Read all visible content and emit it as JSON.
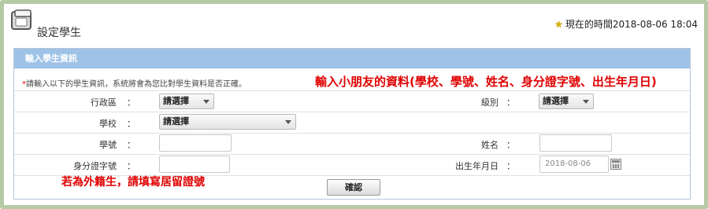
{
  "header": {
    "title": "設定學生",
    "time_label": "現在的時間2018-08-06 18:04"
  },
  "panel": {
    "title": "輸入學生資訊",
    "note_mark": "*",
    "note": "請輸入以下的學生資訊，系統將會為您比對學生資料是否正確。"
  },
  "annotations": {
    "top": "輸入小朋友的資料(學校、學號、姓名、身分證字號、出生年月日)",
    "bottom": "若為外籍生，請填寫居留證號"
  },
  "form": {
    "colon": "：",
    "district_label": "行政區",
    "district_value": "請選擇",
    "grade_label": "級別",
    "grade_value": "請選擇",
    "school_label": "學校",
    "school_value": "請選擇",
    "student_no_label": "學號",
    "student_no_value": "",
    "name_label": "姓名",
    "name_value": "",
    "id_label": "身分證字號",
    "id_value": "",
    "birth_label": "出生年月日",
    "birth_value": "2018-08-06",
    "confirm_label": "確認"
  }
}
